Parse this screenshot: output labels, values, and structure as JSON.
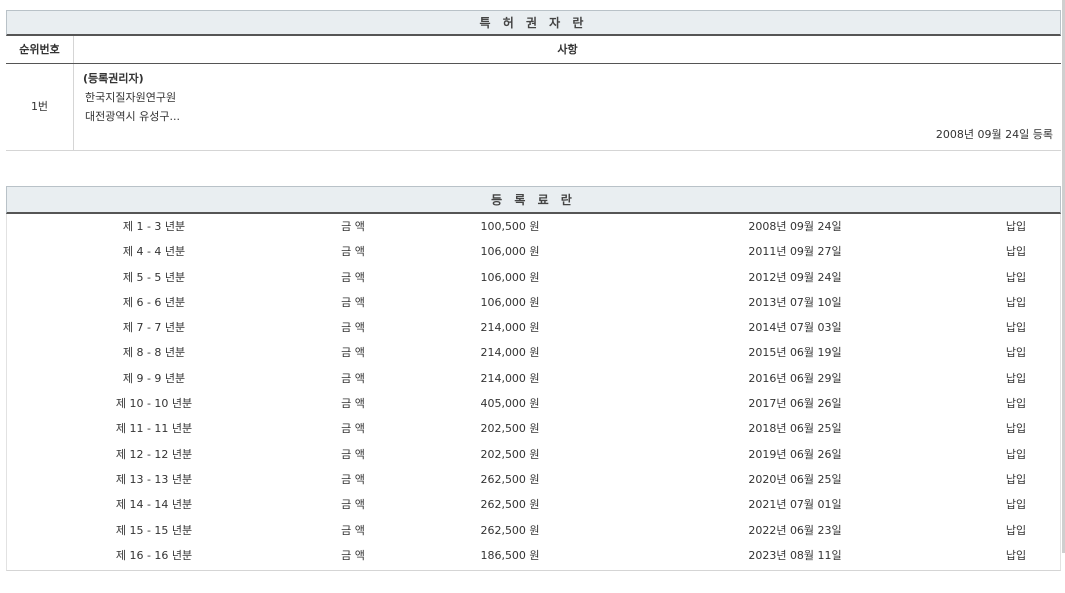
{
  "owner_section": {
    "title": "특 허 권 자 란",
    "col_rank": "순위번호",
    "col_matter": "사항",
    "rank": "1번",
    "holder_label": "(등록권리자)",
    "holder_name": "한국지질자원연구원",
    "holder_address": "대전광역시 유성구...",
    "reg_date": "2008년 09월 24일 등록"
  },
  "fee_section": {
    "title": "등 록 료 란",
    "rows": [
      {
        "year": "제 1 - 3 년분",
        "label": "금 액",
        "amount": "100,500 원",
        "date": "2008년 09월 24일",
        "status": "납입"
      },
      {
        "year": "제 4 - 4 년분",
        "label": "금 액",
        "amount": "106,000 원",
        "date": "2011년 09월 27일",
        "status": "납입"
      },
      {
        "year": "제 5 - 5 년분",
        "label": "금 액",
        "amount": "106,000 원",
        "date": "2012년 09월 24일",
        "status": "납입"
      },
      {
        "year": "제 6 - 6 년분",
        "label": "금 액",
        "amount": "106,000 원",
        "date": "2013년 07월 10일",
        "status": "납입"
      },
      {
        "year": "제 7 - 7 년분",
        "label": "금 액",
        "amount": "214,000 원",
        "date": "2014년 07월 03일",
        "status": "납입"
      },
      {
        "year": "제 8 - 8 년분",
        "label": "금 액",
        "amount": "214,000 원",
        "date": "2015년 06월 19일",
        "status": "납입"
      },
      {
        "year": "제 9 - 9 년분",
        "label": "금 액",
        "amount": "214,000 원",
        "date": "2016년 06월 29일",
        "status": "납입"
      },
      {
        "year": "제 10 - 10 년분",
        "label": "금 액",
        "amount": "405,000 원",
        "date": "2017년 06월 26일",
        "status": "납입"
      },
      {
        "year": "제 11 - 11 년분",
        "label": "금 액",
        "amount": "202,500 원",
        "date": "2018년 06월 25일",
        "status": "납입"
      },
      {
        "year": "제 12 - 12 년분",
        "label": "금 액",
        "amount": "202,500 원",
        "date": "2019년 06월 26일",
        "status": "납입"
      },
      {
        "year": "제 13 - 13 년분",
        "label": "금 액",
        "amount": "262,500 원",
        "date": "2020년 06월 25일",
        "status": "납입"
      },
      {
        "year": "제 14 - 14 년분",
        "label": "금 액",
        "amount": "262,500 원",
        "date": "2021년 07월 01일",
        "status": "납입"
      },
      {
        "year": "제 15 - 15 년분",
        "label": "금 액",
        "amount": "262,500 원",
        "date": "2022년 06월 23일",
        "status": "납입"
      },
      {
        "year": "제 16 - 16 년분",
        "label": "금 액",
        "amount": "186,500 원",
        "date": "2023년 08월 11일",
        "status": "납입"
      }
    ]
  }
}
